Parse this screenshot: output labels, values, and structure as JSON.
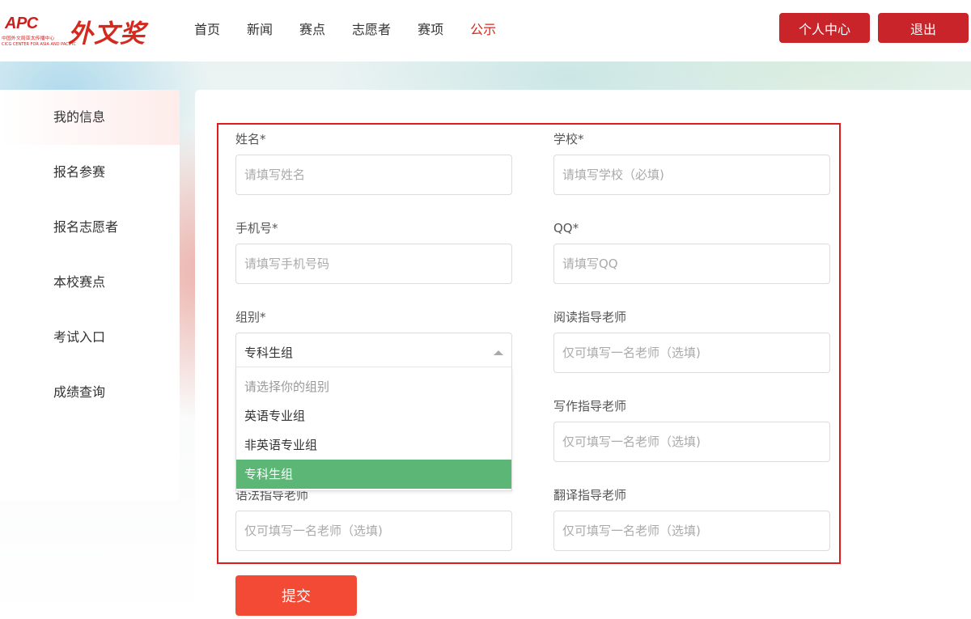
{
  "header": {
    "logo_text": "APC",
    "logo_subtitle": "中国外文局亚太传播中心",
    "logo_subtitle_en": "CICG CENTER FOR ASIA AND PACIFIC",
    "brand": "外文奖",
    "nav": [
      "首页",
      "新闻",
      "赛点",
      "志愿者",
      "赛项",
      "公示"
    ],
    "nav_active": "公示",
    "personal_center": "个人中心",
    "logout": "退出"
  },
  "sidebar": {
    "items": [
      "我的信息",
      "报名参赛",
      "报名志愿者",
      "本校赛点",
      "考试入口",
      "成绩查询"
    ],
    "active": "我的信息"
  },
  "form": {
    "name": {
      "label": "姓名*",
      "placeholder": "请填写姓名"
    },
    "school": {
      "label": "学校*",
      "placeholder": "请填写学校（必填)"
    },
    "phone": {
      "label": "手机号*",
      "placeholder": "请填写手机号码"
    },
    "qq": {
      "label": "QQ*",
      "placeholder": "请填写QQ"
    },
    "group": {
      "label": "组别*",
      "value": "专科生组",
      "options": [
        "请选择你的组别",
        "英语专业组",
        "非英语专业组",
        "专科生组"
      ],
      "selected": "专科生组"
    },
    "reading_teacher": {
      "label": "阅读指导老师",
      "placeholder": "仅可填写一名老师（选填)"
    },
    "writing_teacher": {
      "label": "写作指导老师",
      "placeholder": "仅可填写一名老师（选填)"
    },
    "grammar_teacher": {
      "label": "语法指导老师",
      "placeholder": "仅可填写一名老师（选填)"
    },
    "translation_teacher": {
      "label": "翻译指导老师",
      "placeholder": "仅可填写一名老师（选填)"
    },
    "submit": "提交"
  },
  "colors": {
    "brand_red": "#c8242a",
    "active_red": "#d42a1e",
    "submit": "#f24a35",
    "selected_option": "#5cb776",
    "highlight_border": "#e01b1b"
  }
}
